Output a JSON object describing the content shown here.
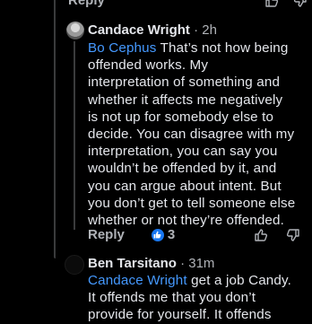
{
  "top_action": {
    "reply_label": "Reply"
  },
  "comment1": {
    "author": "Candace Wright",
    "separator": " · ",
    "time": "2h",
    "mention": "Bo Cephus",
    "lines": [
      " That’s not how being",
      "offended works. My",
      "interpretation of something and",
      "whether it affects me negatively",
      "is not up for somebody else to",
      "decide. You can disagree with my",
      "interpretation, you can say you",
      "wouldn’t be offended by it, and",
      "you can argue about intent. But",
      "you don’t get to tell someone else",
      "whether or not they’re offended."
    ],
    "reply_label": "Reply",
    "like_count": "3"
  },
  "comment2": {
    "author": "Ben Tarsitano",
    "separator": " · ",
    "time": "31m",
    "mention": "Candace Wright",
    "lines": [
      " get a job Candy.",
      "It offends me that you don’t",
      "provide for yourself. It offends"
    ]
  },
  "colors": {
    "background": "#000000",
    "text": "#E4E6EB",
    "muted": "#B0B3B8",
    "mention": "#4599FF",
    "like_badge": "#1877F2"
  },
  "icons": [
    "thumbs-up-icon",
    "thumbs-down-icon",
    "like-reaction-icon"
  ]
}
